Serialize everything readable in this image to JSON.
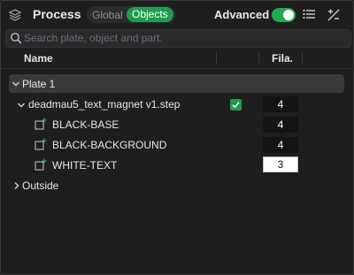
{
  "header": {
    "title": "Process",
    "tabs": [
      "Global",
      "Objects"
    ],
    "active_tab": "Objects",
    "advanced_label": "Advanced",
    "advanced_enabled": true
  },
  "search": {
    "placeholder": "Search plate, object and part.",
    "value": ""
  },
  "columns": {
    "name": "Name",
    "filament": "Fila."
  },
  "tree": {
    "plate": {
      "label": "Plate 1",
      "expanded": true
    },
    "object": {
      "label": "deadmau5_text_magnet v1.step",
      "filament": "4",
      "checked": true,
      "expanded": true
    },
    "parts": [
      {
        "label": "BLACK-BASE",
        "filament": "4"
      },
      {
        "label": "BLACK-BACKGROUND",
        "filament": "4"
      },
      {
        "label": "WHITE-TEXT",
        "filament": "3"
      }
    ],
    "outside": {
      "label": "Outside",
      "expanded": false
    }
  },
  "colors": {
    "accent": "#1f9b4c",
    "toggle": "#1fa951",
    "background": "#1e1e1f",
    "row_highlight": "#3a3a3c"
  }
}
